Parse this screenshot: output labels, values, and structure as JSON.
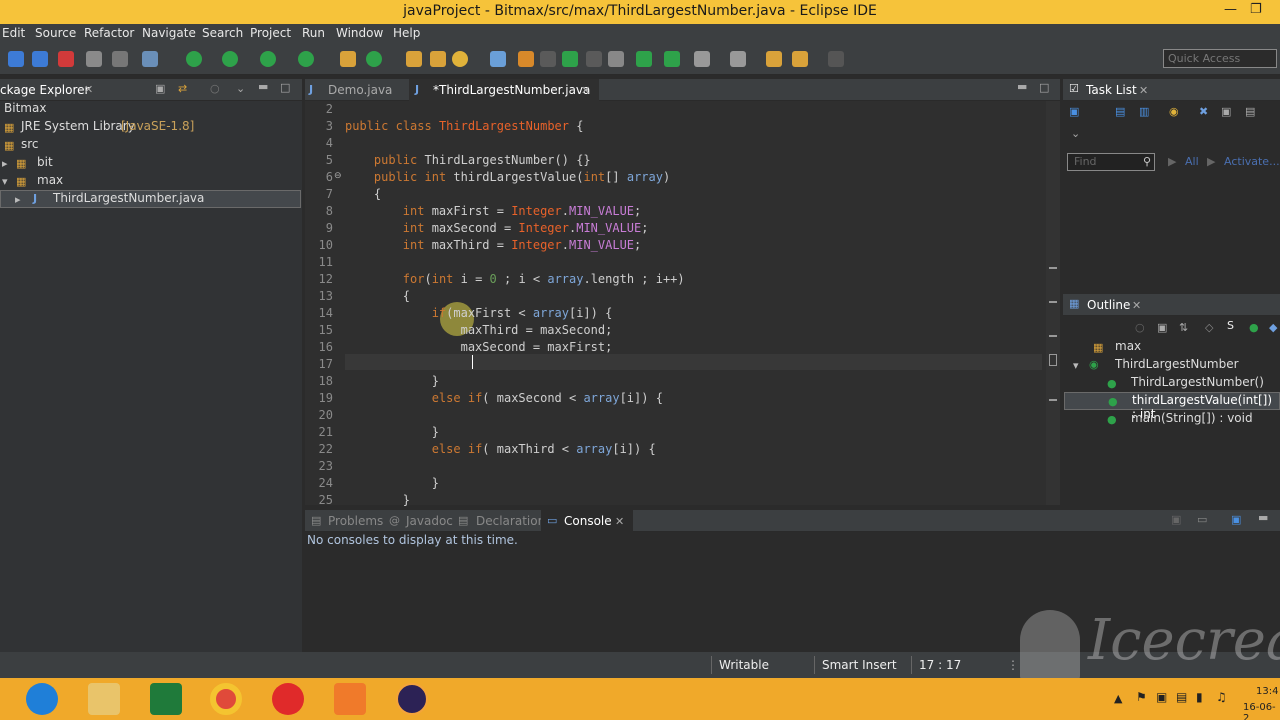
{
  "window": {
    "title": "javaProject - Bitmax/src/max/ThirdLargestNumber.java - Eclipse IDE"
  },
  "menu": [
    "Edit",
    "Source",
    "Refactor",
    "Navigate",
    "Search",
    "Project",
    "Run",
    "Window",
    "Help"
  ],
  "quick_access": {
    "placeholder": "Quick Access"
  },
  "package_explorer": {
    "tab_label": "ckage Explorer",
    "tree": {
      "project": "Bitmax",
      "jre": "JRE System Library",
      "jre_version": "[JavaSE-1.8]",
      "src": "src",
      "pkg1": "bit",
      "pkg2": "max",
      "file": "ThirdLargestNumber.java"
    }
  },
  "editor": {
    "tabs": [
      "Demo.java",
      "*ThirdLargestNumber.java"
    ],
    "lines": [
      {
        "n": "2",
        "code": ""
      },
      {
        "n": "3",
        "code": "public class ThirdLargestNumber {"
      },
      {
        "n": "4",
        "code": ""
      },
      {
        "n": "5",
        "code": "    public ThirdLargestNumber() {}"
      },
      {
        "n": "6",
        "code": "    public int thirdLargestValue(int[] array)"
      },
      {
        "n": "7",
        "code": "    {"
      },
      {
        "n": "8",
        "code": "        int maxFirst = Integer.MIN_VALUE;"
      },
      {
        "n": "9",
        "code": "        int maxSecond = Integer.MIN_VALUE;"
      },
      {
        "n": "10",
        "code": "        int maxThird = Integer.MIN_VALUE;"
      },
      {
        "n": "11",
        "code": ""
      },
      {
        "n": "12",
        "code": "        for(int i = 0 ; i < array.length ; i++)"
      },
      {
        "n": "13",
        "code": "        {"
      },
      {
        "n": "14",
        "code": "            if(maxFirst < array[i]) {"
      },
      {
        "n": "15",
        "code": "                maxThird = maxSecond;"
      },
      {
        "n": "16",
        "code": "                maxSecond = maxFirst;"
      },
      {
        "n": "17",
        "code": ""
      },
      {
        "n": "18",
        "code": "            }"
      },
      {
        "n": "19",
        "code": "            else if( maxSecond < array[i]) {"
      },
      {
        "n": "20",
        "code": ""
      },
      {
        "n": "21",
        "code": "            }"
      },
      {
        "n": "22",
        "code": "            else if( maxThird < array[i]) {"
      },
      {
        "n": "23",
        "code": ""
      },
      {
        "n": "24",
        "code": "            }"
      },
      {
        "n": "25",
        "code": "        }"
      }
    ]
  },
  "task_list": {
    "tab_label": "Task List",
    "find_placeholder": "Find",
    "all_label": "All",
    "activate_label": "Activate..."
  },
  "outline": {
    "tab_label": "Outline",
    "items": [
      {
        "label": "max"
      },
      {
        "label": "ThirdLargestNumber"
      },
      {
        "label": "ThirdLargestNumber()"
      },
      {
        "label": "thirdLargestValue(int[]) : int"
      },
      {
        "label": "main(String[]) : void"
      }
    ]
  },
  "console": {
    "tabs": [
      "Problems",
      "Javadoc",
      "Declaration",
      "Console"
    ],
    "message": "No consoles to display at this time."
  },
  "status": {
    "writable": "Writable",
    "insert_mode": "Smart Insert",
    "position": "17 : 17"
  },
  "watermark": "Icecream",
  "taskbar": {
    "time": "13:4",
    "date": "16-06-2"
  }
}
